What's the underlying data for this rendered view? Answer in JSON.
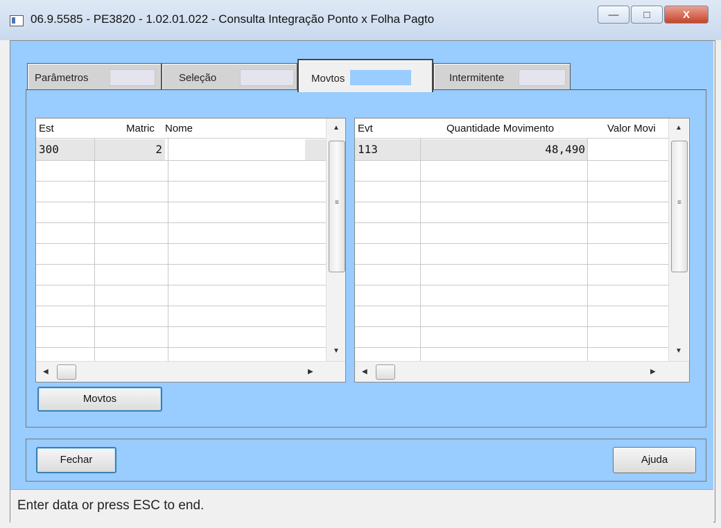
{
  "window": {
    "title": "06.9.5585 - PE3820 - 1.02.01.022 - Consulta Integração Ponto x Folha Pagto",
    "minimize_glyph": "—",
    "maximize_glyph": "□",
    "close_glyph": "X"
  },
  "tabs": [
    {
      "label": "Parâmetros",
      "active": false
    },
    {
      "label": "Seleção",
      "active": false
    },
    {
      "label": "Movtos",
      "active": true
    },
    {
      "label": "Intermitente",
      "active": false
    }
  ],
  "left_grid": {
    "columns": [
      "Est",
      "Matric",
      "Nome"
    ],
    "rows": [
      {
        "est": "300",
        "matric": "2",
        "nome": ""
      }
    ]
  },
  "right_grid": {
    "columns": [
      "Evt",
      "Quantidade Movimento",
      "Valor Movi"
    ],
    "rows": [
      {
        "evt": "113",
        "quantidade": "48,490",
        "valor": ""
      }
    ]
  },
  "buttons": {
    "movtos": "Movtos",
    "fechar": "Fechar",
    "ajuda": "Ajuda"
  },
  "status": "Enter data or press ESC to end.",
  "colors": {
    "panel_blue": "#99ccff",
    "selected_row": "#e6e6e6"
  }
}
